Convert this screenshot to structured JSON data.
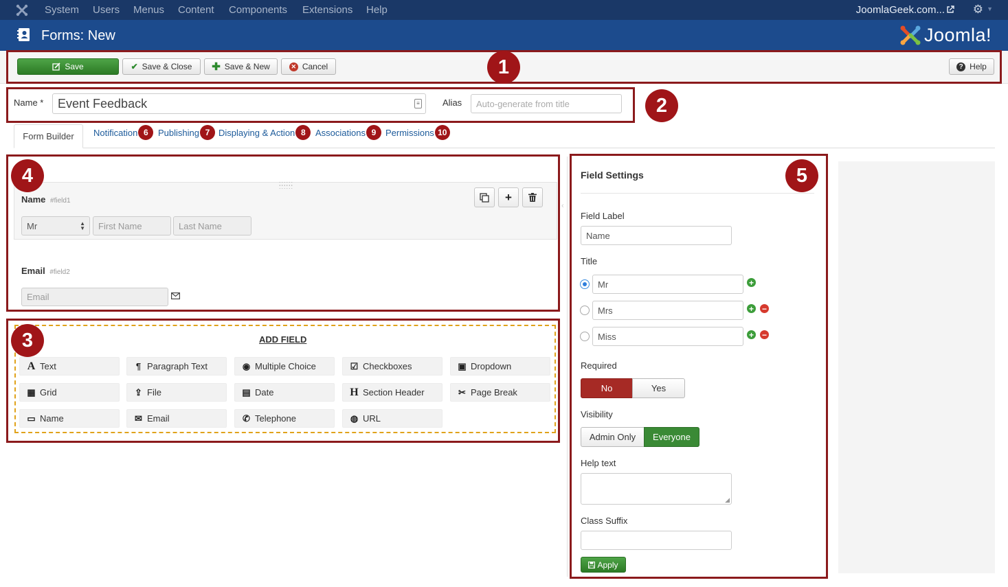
{
  "topbar": {
    "menu": [
      "System",
      "Users",
      "Menus",
      "Content",
      "Components",
      "Extensions",
      "Help"
    ],
    "site_link": "JoomlaGeek.com...",
    "icons": [
      "joomla-icon",
      "external-link-icon",
      "gear-icon",
      "caret-down-icon"
    ]
  },
  "header": {
    "title": "Forms: New",
    "logo_text": "Joomla!"
  },
  "toolbar": {
    "save": "Save",
    "save_close": "Save & Close",
    "save_new": "Save & New",
    "cancel": "Cancel",
    "help": "Help"
  },
  "details": {
    "name_label": "Name *",
    "name_value": "Event Feedback",
    "alias_label": "Alias",
    "alias_placeholder": "Auto-generate from title"
  },
  "tabs": [
    {
      "label": "Form Builder",
      "marker": ""
    },
    {
      "label": "Notification",
      "marker": "6"
    },
    {
      "label": "Publishing",
      "marker": "7"
    },
    {
      "label": "Displaying & Action",
      "marker": "8"
    },
    {
      "label": "Associations",
      "marker": "9"
    },
    {
      "label": "Permissions",
      "marker": "10"
    }
  ],
  "markers": {
    "m1": "1",
    "m2": "2",
    "m3": "3",
    "m4": "4",
    "m5": "5"
  },
  "canvas": {
    "field1": {
      "label": "Name",
      "id": "#field1",
      "title_value": "Mr",
      "first_placeholder": "First Name",
      "last_placeholder": "Last Name"
    },
    "field2": {
      "label": "Email",
      "id": "#field2",
      "placeholder": "Email"
    }
  },
  "add_field": {
    "heading": "ADD FIELD",
    "buttons": [
      {
        "label": "Text",
        "icon": "text-icon"
      },
      {
        "label": "Paragraph Text",
        "icon": "paragraph-icon"
      },
      {
        "label": "Multiple Choice",
        "icon": "radio-icon"
      },
      {
        "label": "Checkboxes",
        "icon": "checkbox-icon"
      },
      {
        "label": "Dropdown",
        "icon": "dropdown-icon"
      },
      {
        "label": "Grid",
        "icon": "grid-icon"
      },
      {
        "label": "File",
        "icon": "upload-icon"
      },
      {
        "label": "Date",
        "icon": "calendar-icon"
      },
      {
        "label": "Section Header",
        "icon": "header-icon"
      },
      {
        "label": "Page Break",
        "icon": "scissors-icon"
      },
      {
        "label": "Name",
        "icon": "name-card-icon"
      },
      {
        "label": "Email",
        "icon": "envelope-icon"
      },
      {
        "label": "Telephone",
        "icon": "phone-icon"
      },
      {
        "label": "URL",
        "icon": "globe-icon"
      }
    ]
  },
  "settings": {
    "title": "Field Settings",
    "field_label": "Field Label",
    "field_label_value": "Name",
    "title_label": "Title",
    "options": [
      {
        "value": "Mr",
        "selected": true
      },
      {
        "value": "Mrs",
        "selected": false
      },
      {
        "value": "Miss",
        "selected": false
      }
    ],
    "required_label": "Required",
    "required_no": "No",
    "required_yes": "Yes",
    "visibility_label": "Visibility",
    "vis_admin": "Admin Only",
    "vis_everyone": "Everyone",
    "help_text_label": "Help text",
    "class_suffix_label": "Class Suffix",
    "apply": "Apply"
  },
  "colors": {
    "topbar": "#1a3867",
    "header": "#1c4b8d",
    "highlight": "#8b1a1c",
    "marker": "#a01518",
    "link": "#1c5a9a",
    "green": "#2c7a25",
    "danger_active": "#a62a25"
  }
}
